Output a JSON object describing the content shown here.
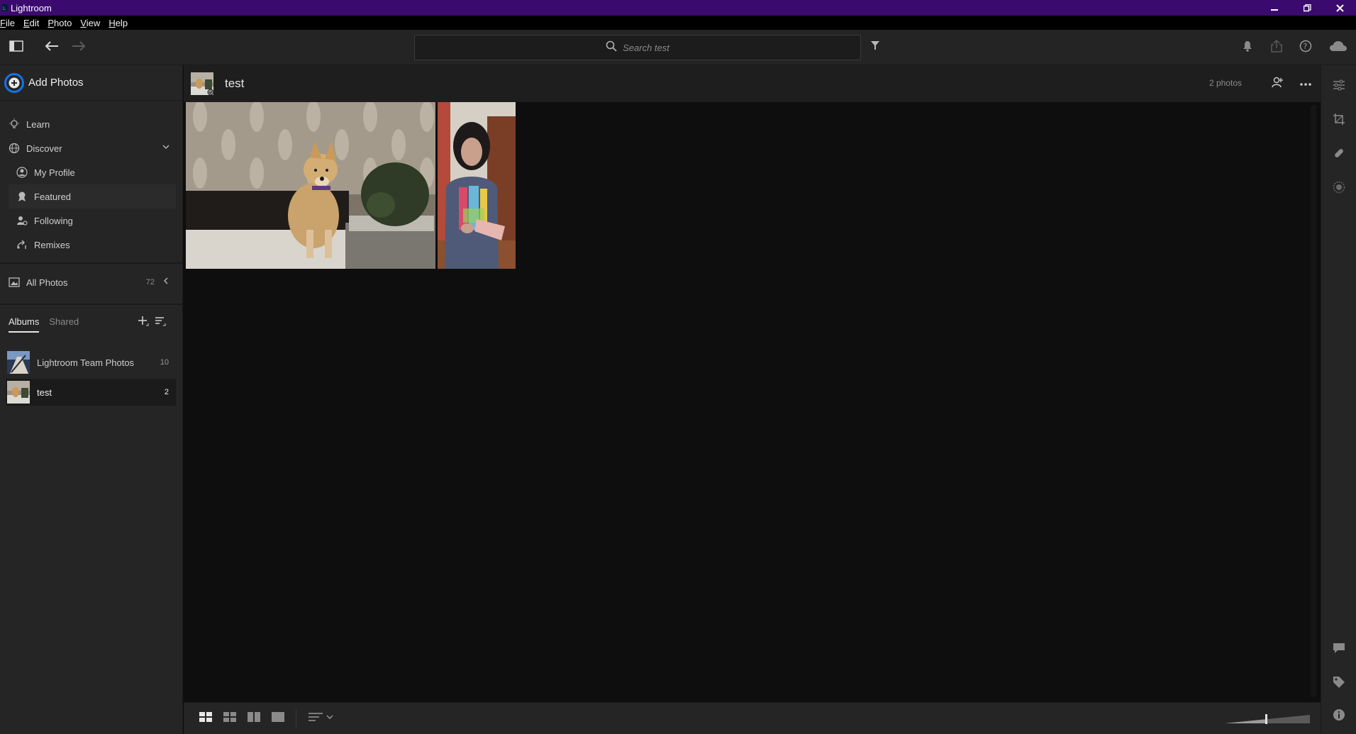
{
  "window": {
    "title": "Lightroom",
    "controls": [
      "minimize",
      "restore",
      "close"
    ]
  },
  "menu": [
    {
      "label": "File",
      "key": "F",
      "rest": "ile"
    },
    {
      "label": "Edit",
      "key": "E",
      "rest": "dit"
    },
    {
      "label": "Photo",
      "key": "P",
      "rest": "hoto"
    },
    {
      "label": "View",
      "key": "V",
      "rest": "iew"
    },
    {
      "label": "Help",
      "key": "H",
      "rest": "elp"
    }
  ],
  "toolbar": {
    "search_placeholder": "Search test",
    "icons": [
      "panel-toggle-icon",
      "back-arrow-icon",
      "forward-arrow-icon",
      "filter-icon",
      "bell-icon",
      "share-icon",
      "help-icon",
      "cloud-icon"
    ]
  },
  "sidebar": {
    "add_photos_label": "Add Photos",
    "learn_label": "Learn",
    "discover_label": "Discover",
    "discover_items": [
      {
        "label": "My Profile",
        "icon": "profile-icon"
      },
      {
        "label": "Featured",
        "icon": "award-icon"
      },
      {
        "label": "Following",
        "icon": "following-icon"
      },
      {
        "label": "Remixes",
        "icon": "remix-icon"
      }
    ],
    "all_photos_label": "All Photos",
    "all_photos_count": "72",
    "tabs": [
      "Albums",
      "Shared"
    ],
    "active_tab": "Albums",
    "albums": [
      {
        "name": "Lightroom Team Photos",
        "count": "10"
      },
      {
        "name": "test",
        "count": "2"
      }
    ],
    "active_album": "test"
  },
  "content": {
    "album_title": "test",
    "photo_count": "2 photos",
    "photos": [
      {
        "subject": "dog sitting on a couch"
      },
      {
        "subject": "woman holding a colorful card"
      }
    ]
  },
  "bottombar": {
    "views": [
      "square-grid-view",
      "small-grid-view",
      "compare-view",
      "detail-view"
    ],
    "active_view": "square-grid-view",
    "sort_icon": "sort-icon"
  },
  "right_panel": {
    "top_tools": [
      "edit-sliders-icon",
      "crop-icon",
      "healing-icon",
      "masking-icon"
    ],
    "bottom_tools": [
      "comment-icon",
      "tag-icon",
      "info-icon"
    ]
  },
  "colors": {
    "titlebar": "#3a0a6e",
    "accent": "#1473e6",
    "panel": "#252525",
    "canvas": "#0e0e0e"
  }
}
